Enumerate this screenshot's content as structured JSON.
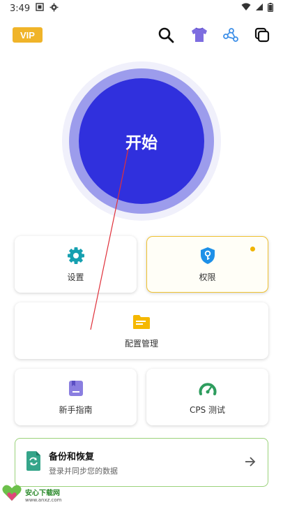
{
  "status_bar": {
    "time": "3:49"
  },
  "header": {
    "vip_label": "VIP"
  },
  "start_button": {
    "label": "开始"
  },
  "tiles": {
    "settings": {
      "label": "设置"
    },
    "permissions": {
      "label": "权限"
    },
    "config": {
      "label": "配置管理"
    },
    "guide": {
      "label": "新手指南"
    },
    "cps": {
      "label": "CPS 测试"
    }
  },
  "backup": {
    "title": "备份和恢复",
    "subtitle": "登录并同步您的数据"
  },
  "watermark": {
    "title": "安心下载网",
    "url": "www.anxz.com"
  },
  "colors": {
    "accent": "#3030dd",
    "vip": "#f0b429",
    "settings_icon": "#16a0b0",
    "permission_icon": "#1e90e8",
    "folder_icon": "#f5b800",
    "guide_icon": "#8a7ee0",
    "gauge_icon": "#2e9d5e",
    "backup_border": "#9ad27a"
  }
}
